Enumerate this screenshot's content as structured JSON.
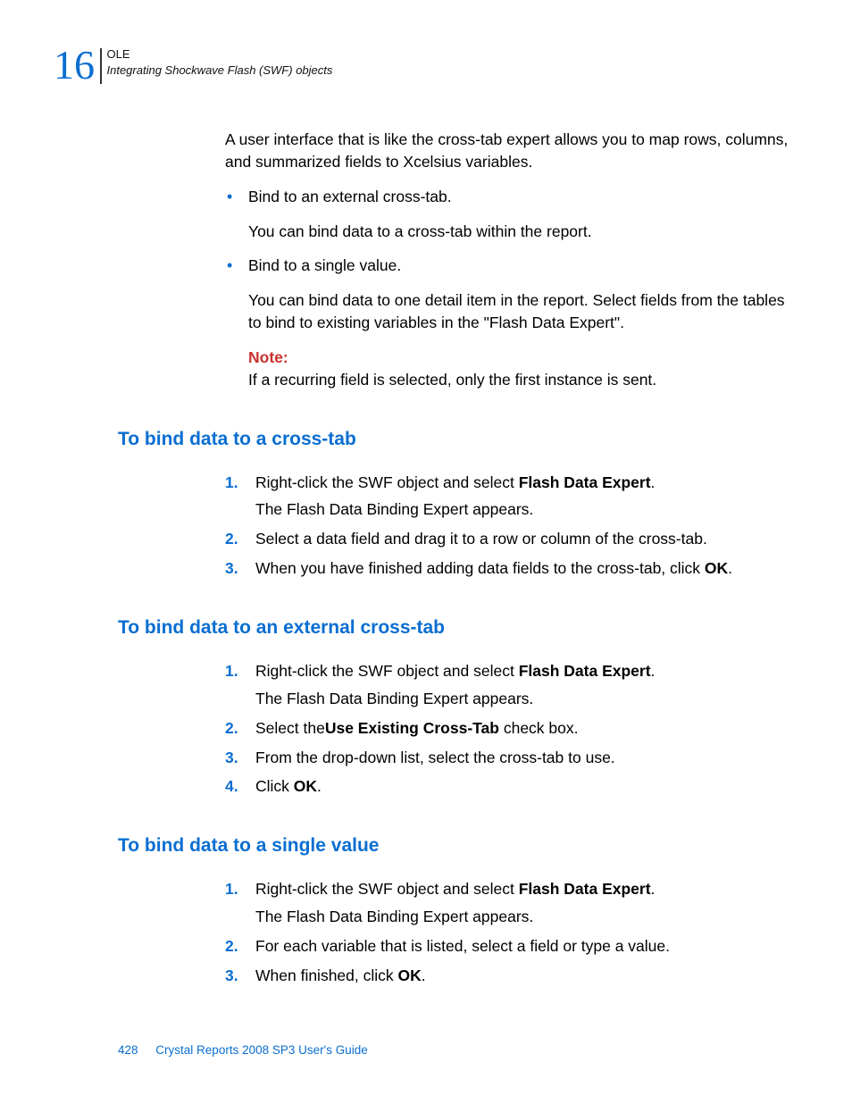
{
  "header": {
    "chapter_number": "16",
    "label_top": "OLE",
    "label_sub": "Integrating Shockwave Flash (SWF) objects"
  },
  "intro": {
    "para1": "A user interface that is like the cross-tab expert allows you to map rows, columns, and summarized fields to Xcelsius variables.",
    "bullets": [
      {
        "title": "Bind to an external cross-tab.",
        "body": "You can bind data to a cross-tab within the report."
      },
      {
        "title": "Bind to a single value.",
        "body": "You can bind data to one detail item in the report. Select fields from the tables to bind to existing variables in the \"Flash Data Expert\".",
        "note_label": "Note:",
        "note_body": "If a recurring field is selected, only the first instance is sent."
      }
    ]
  },
  "sections": [
    {
      "heading": "To bind data to a cross-tab",
      "steps": [
        {
          "pre": "Right-click the SWF object and select ",
          "bold": "Flash Data Expert",
          "post": ".",
          "sub": "The Flash Data Binding Expert appears."
        },
        {
          "pre": "Select a data field and drag it to a row or column of the cross-tab.",
          "bold": "",
          "post": ""
        },
        {
          "pre": "When you have finished adding data fields to the cross-tab, click ",
          "bold": "OK",
          "post": "."
        }
      ]
    },
    {
      "heading": "To bind data to an external cross-tab",
      "steps": [
        {
          "pre": "Right-click the SWF object and select ",
          "bold": "Flash Data Expert",
          "post": ".",
          "sub": "The Flash Data Binding Expert appears."
        },
        {
          "pre": "Select the",
          "bold": "Use Existing Cross-Tab",
          "post": " check box."
        },
        {
          "pre": "From the drop-down list, select the cross-tab to use.",
          "bold": "",
          "post": ""
        },
        {
          "pre": "Click ",
          "bold": "OK",
          "post": "."
        }
      ]
    },
    {
      "heading": "To bind data to a single value",
      "steps": [
        {
          "pre": "Right-click the SWF object and select ",
          "bold": "Flash Data Expert",
          "post": ".",
          "sub": "The Flash Data Binding Expert appears."
        },
        {
          "pre": "For each variable that is listed, select a field or type a value.",
          "bold": "",
          "post": ""
        },
        {
          "pre": "When finished, click ",
          "bold": "OK",
          "post": "."
        }
      ]
    }
  ],
  "footer": {
    "page_number": "428",
    "doc_title": "Crystal Reports 2008 SP3 User's Guide"
  }
}
